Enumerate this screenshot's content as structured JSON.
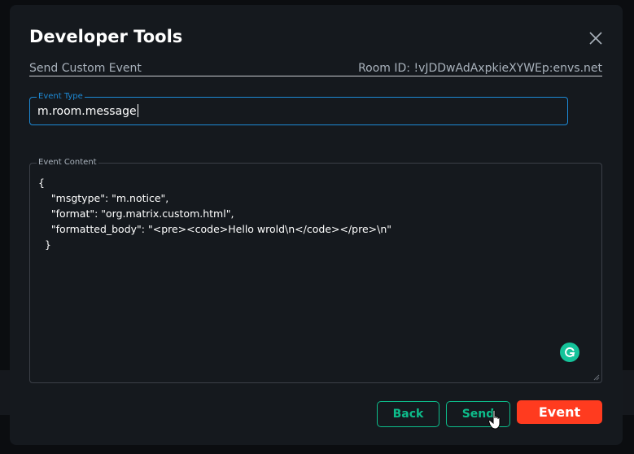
{
  "dialog": {
    "title": "Developer Tools",
    "subtitle_left": "Send Custom Event",
    "subtitle_right": "Room ID: !vJDDwAdAxpkieXYWEp:envs.net"
  },
  "event_type": {
    "label": "Event Type",
    "value": "m.room.message"
  },
  "event_content": {
    "label": "Event Content",
    "value": "{\n    \"msgtype\": \"m.notice\",\n    \"format\": \"org.matrix.custom.html\",\n    \"formatted_body\": \"<pre><code>Hello wrold\\n</code></pre>\\n\"\n  }"
  },
  "buttons": {
    "back": "Back",
    "send": "Send",
    "event": "Event"
  },
  "colors": {
    "accent": "#0dbd8b",
    "focus": "#1d8ad6",
    "danger": "#ff3b1f"
  }
}
